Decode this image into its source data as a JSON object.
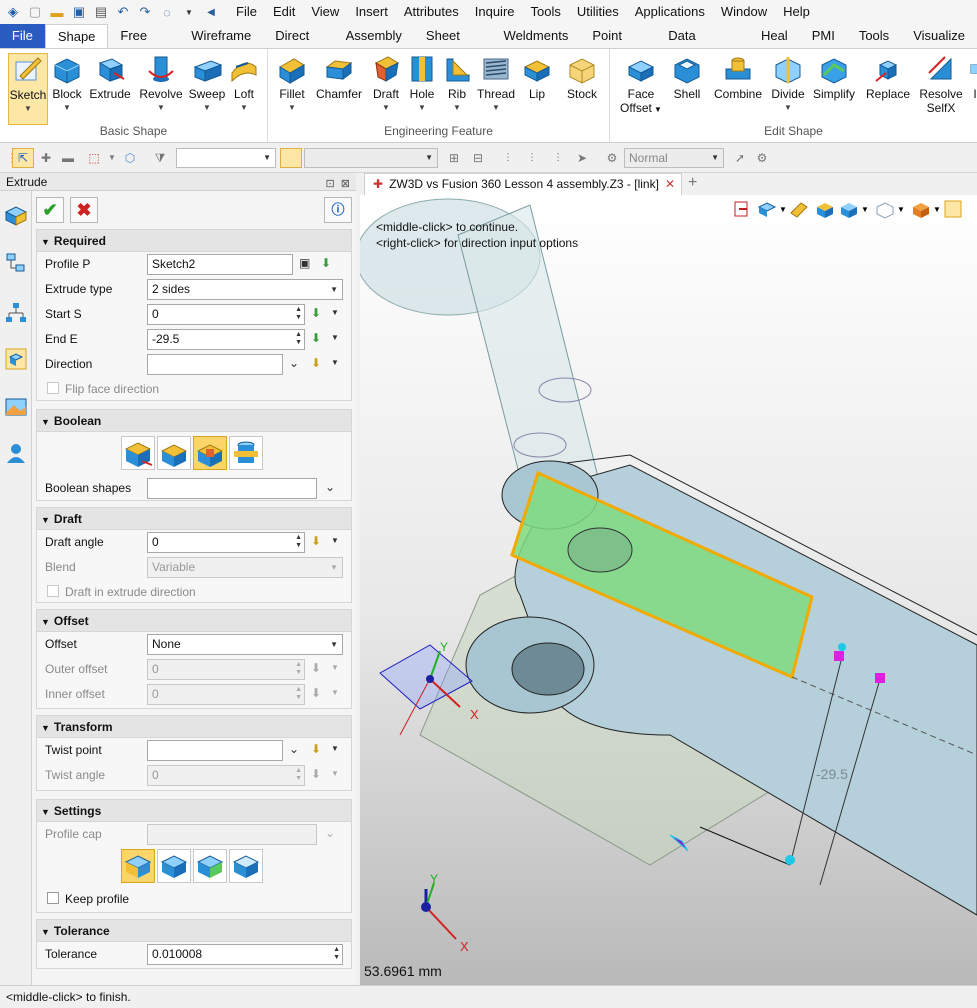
{
  "menu": {
    "items": [
      "File",
      "Edit",
      "View",
      "Insert",
      "Attributes",
      "Inquire",
      "Tools",
      "Utilities",
      "Applications",
      "Window",
      "Help"
    ]
  },
  "tabs": [
    "File",
    "Shape",
    "Free Form",
    "Wireframe",
    "Direct Edit",
    "Assembly",
    "Sheet Metal",
    "Weldments",
    "Point Cloud",
    "Data Exchange",
    "Heal",
    "PMI",
    "Tools",
    "Visualize"
  ],
  "ribbon": {
    "basic_shape": {
      "label": "Basic Shape",
      "buttons": [
        "Sketch",
        "Block",
        "Extrude",
        "Revolve",
        "Sweep",
        "Loft"
      ]
    },
    "engineering": {
      "label": "Engineering Feature",
      "buttons": [
        "Fillet",
        "Chamfer",
        "Draft",
        "Hole",
        "Rib",
        "Thread",
        "Lip",
        "Stock"
      ]
    },
    "edit_shape": {
      "label": "Edit Shape",
      "face_offset": "Face",
      "face_offset2": "Offset",
      "buttons": [
        "Shell",
        "Combine",
        "Divide",
        "Simplify",
        "Replace"
      ],
      "resolve": "Resolve",
      "resolve2": "SelfX",
      "partial": "I"
    }
  },
  "toolbar2": {
    "mode_value": "Normal"
  },
  "panel": {
    "title": "Extrude",
    "required": {
      "header": "Required",
      "profile_label": "Profile P",
      "profile_value": "Sketch2",
      "type_label": "Extrude type",
      "type_value": "2 sides",
      "start_label": "Start S",
      "start_value": "0",
      "end_label": "End E",
      "end_value": "-29.5",
      "direction_label": "Direction",
      "direction_value": "",
      "flip_label": "Flip face direction"
    },
    "boolean": {
      "header": "Boolean",
      "shapes_label": "Boolean shapes"
    },
    "draft": {
      "header": "Draft",
      "angle_label": "Draft angle",
      "angle_value": "0",
      "blend_label": "Blend",
      "blend_value": "Variable",
      "draft_dir_label": "Draft in extrude direction"
    },
    "offset": {
      "header": "Offset",
      "offset_label": "Offset",
      "offset_value": "None",
      "outer_label": "Outer offset",
      "outer_value": "0",
      "inner_label": "Inner offset",
      "inner_value": "0"
    },
    "transform": {
      "header": "Transform",
      "twist_point_label": "Twist point",
      "twist_angle_label": "Twist angle",
      "twist_angle_value": "0"
    },
    "settings": {
      "header": "Settings",
      "profile_cap_label": "Profile cap",
      "keep_profile_label": "Keep profile"
    },
    "tolerance": {
      "header": "Tolerance",
      "tolerance_label": "Tolerance",
      "tolerance_value": "0.010008"
    }
  },
  "document": {
    "tab_title": "ZW3D vs Fusion 360 Lesson 4 assembly.Z3 - [link]"
  },
  "viewport": {
    "msg1": "<middle-click> to continue.",
    "msg2": "<right-click> for direction input options",
    "dimension": "-29.5",
    "length": "53.6961 mm",
    "axis_x": "X",
    "axis_y": "Y"
  },
  "status": "<middle-click> to finish.",
  "colors": {
    "accent": "#2a5bbf",
    "selected": "#fbd46a",
    "highlight": "#f2a900",
    "preview_green": "#7fdc7f"
  }
}
